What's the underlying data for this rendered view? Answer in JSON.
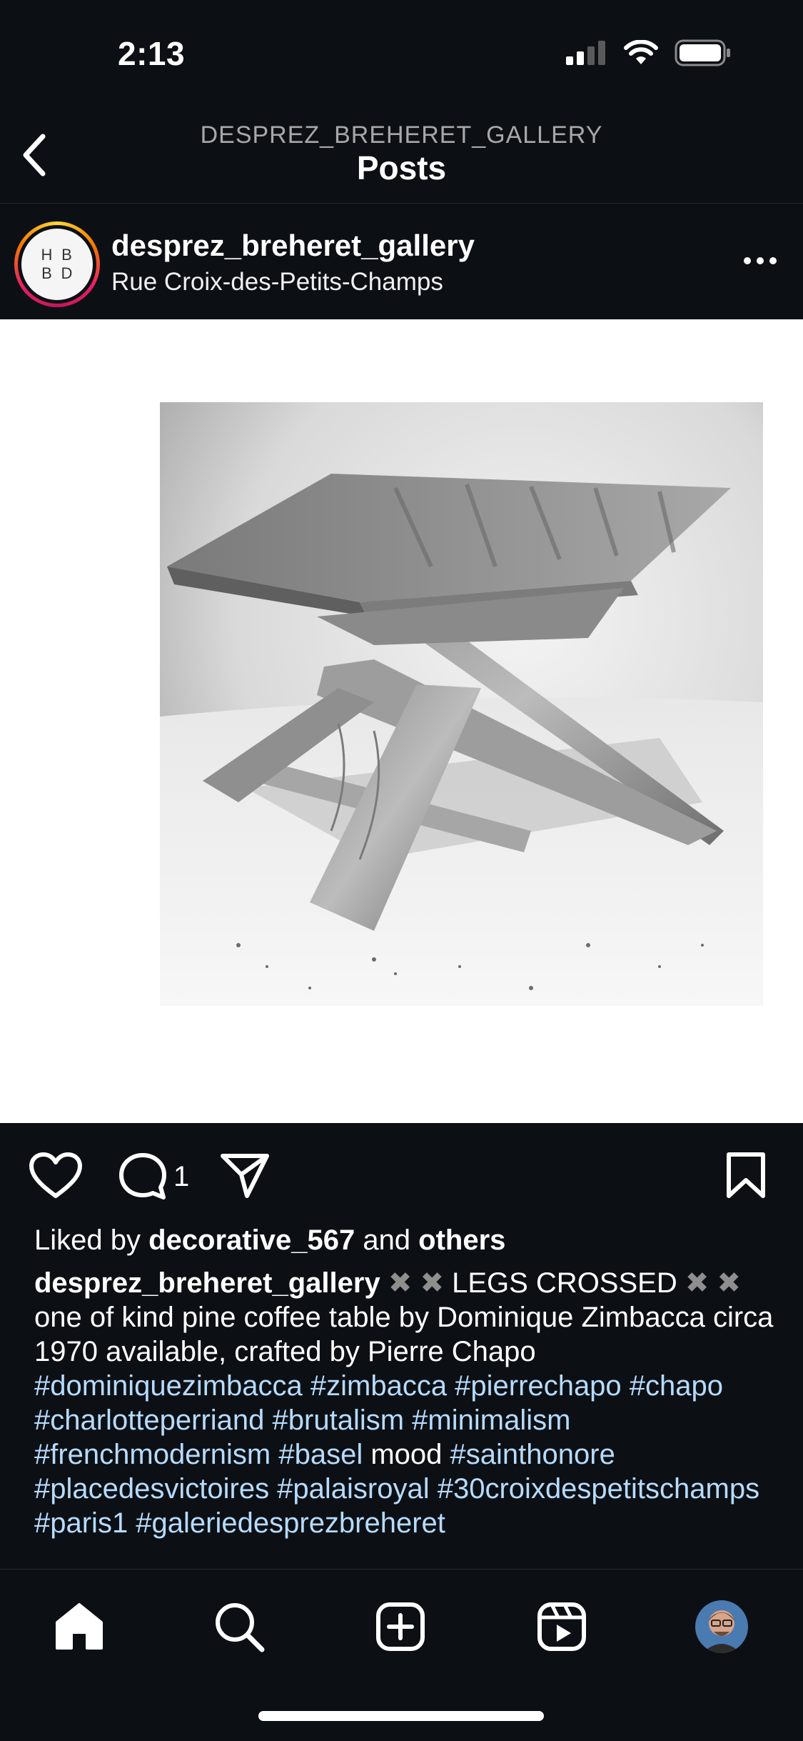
{
  "status_bar": {
    "time": "2:13"
  },
  "header": {
    "subtitle": "DESPREZ_BREHERET_GALLERY",
    "title": "Posts"
  },
  "post": {
    "avatar_letters": [
      "H",
      "B",
      "B",
      "D"
    ],
    "username": "desprez_breheret_gallery",
    "location": "Rue Croix-des-Petits-Champs",
    "comment_count": "1",
    "likes": {
      "prefix": "Liked by ",
      "user": "decorative_567",
      "middle": " and ",
      "suffix": "others"
    },
    "caption": {
      "author": "desprez_breheret_gallery",
      "x1": "✖ ✖",
      "part1": " LEGS CROSSED ",
      "x2": "✖ ✖",
      "part2": " one of kind pine coffee table by Dominique Zimbacca circa 1970 available, crafted by Pierre Chapo ",
      "tags1": "#dominiquezimbacca #zimbacca #pierrechapo #chapo #charlotteperriand #brutalism #minimalism #frenchmodernism #basel",
      "word_mood": " mood ",
      "tags2": "#sainthonore #placedesvictoires #palaisroyal #30croixdespetitschamps #paris1 #galeriedesprezbreheret"
    }
  },
  "colors": {
    "background": "#0c1014",
    "text": "#ffffff",
    "hashtag": "#b6dbff",
    "secondary": "#a8a8a8"
  },
  "icons": {
    "status": [
      "signal-icon",
      "wifi-icon",
      "battery-icon"
    ],
    "actions": [
      "heart-icon",
      "comment-icon",
      "share-icon",
      "bookmark-icon"
    ],
    "nav": [
      "home-icon",
      "search-icon",
      "create-icon",
      "reels-icon",
      "profile-avatar"
    ]
  }
}
